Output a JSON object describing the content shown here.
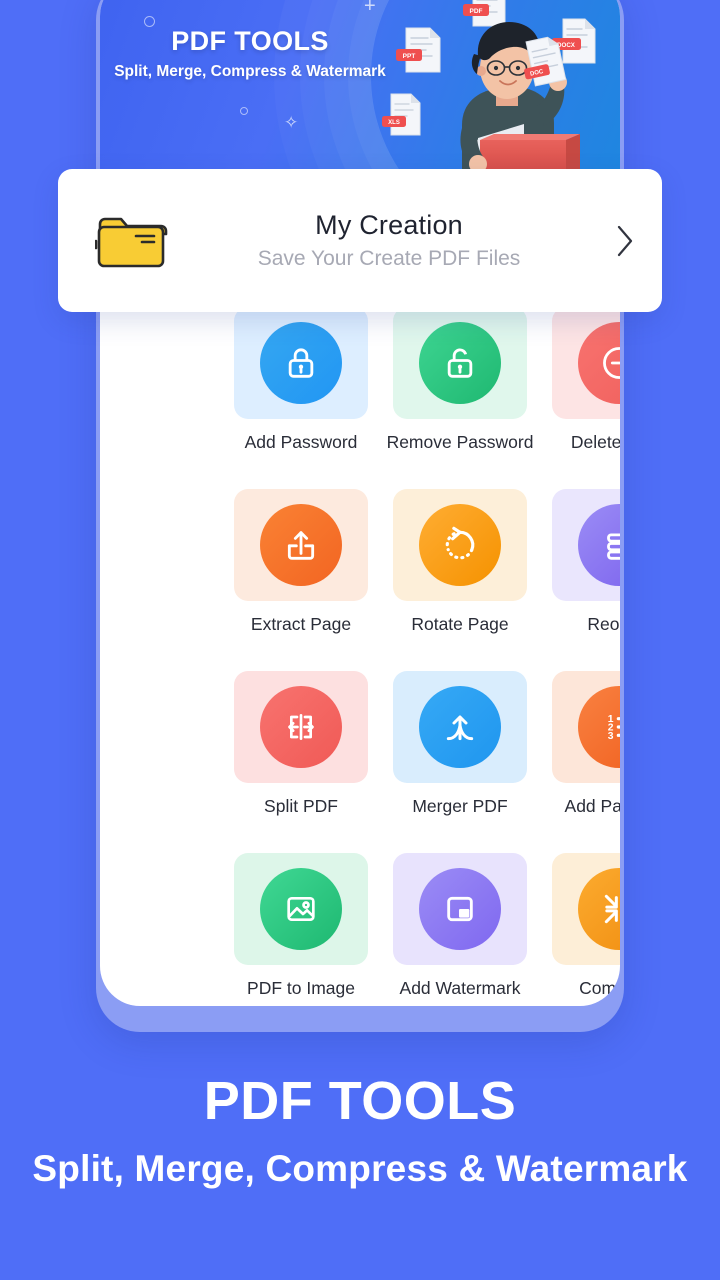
{
  "banner": {
    "title": "PDF TOOLS",
    "subtitle": "Split, Merge, Compress & Watermark",
    "file_cards": [
      "PPT",
      "PDF",
      "DOCX",
      "DOC",
      "XLS"
    ],
    "bg_color": "#4a6ef5"
  },
  "creation": {
    "title": "My Creation",
    "subtitle": "Save Your Create PDF Files",
    "folder_color": "#f8cc34",
    "chevron": "chevron-right"
  },
  "tools": [
    {
      "label": "Add Password",
      "icon": "lock-icon",
      "tile_color": "#ddeeff",
      "circle_from": "#35a7f2",
      "circle_to": "#2196f3"
    },
    {
      "label": "Remove Password",
      "icon": "unlock-icon",
      "tile_color": "#e0f7ec",
      "circle_from": "#3ed592",
      "circle_to": "#1fb871"
    },
    {
      "label": "Delete Page",
      "icon": "minus-circle-icon",
      "tile_color": "#fde4e4",
      "circle_from": "#f8736f",
      "circle_to": "#f0605d"
    },
    {
      "label": "Extract Page",
      "icon": "upload-icon",
      "tile_color": "#fdeade",
      "circle_from": "#fa8234",
      "circle_to": "#f26522"
    },
    {
      "label": "Rotate Page",
      "icon": "rotate-ccw-icon",
      "tile_color": "#fdefd9",
      "circle_from": "#ffad33",
      "circle_to": "#f59200"
    },
    {
      "label": "Reorder",
      "icon": "stacked-bars-icon",
      "tile_color": "#eae6fd",
      "circle_from": "#9b8cf5",
      "circle_to": "#7b62ee"
    },
    {
      "label": "Split PDF",
      "icon": "split-arrows-icon",
      "tile_color": "#fde0e0",
      "circle_from": "#f8736f",
      "circle_to": "#f05a56"
    },
    {
      "label": "Merger PDF",
      "icon": "merge-arrow-icon",
      "tile_color": "#d9edfd",
      "circle_from": "#36a9f5",
      "circle_to": "#1f96ef"
    },
    {
      "label": "Add Page No.",
      "icon": "numbered-list-icon",
      "tile_color": "#fde6d9",
      "circle_from": "#f98141",
      "circle_to": "#f0601f"
    },
    {
      "label": "PDF to Image",
      "icon": "image-icon",
      "tile_color": "#ddf6e9",
      "circle_from": "#40d894",
      "circle_to": "#1eb871"
    },
    {
      "label": "Add Watermark",
      "icon": "watermark-icon",
      "tile_color": "#e8e3fd",
      "circle_from": "#9b8cf5",
      "circle_to": "#7f68f0"
    },
    {
      "label": "Compress",
      "icon": "compress-arrows-icon",
      "tile_color": "#fdeed7",
      "circle_from": "#fcab2f",
      "circle_to": "#f08d10"
    }
  ],
  "promo": {
    "title": "PDF TOOLS",
    "subtitle": "Split, Merge, Compress & Watermark"
  }
}
